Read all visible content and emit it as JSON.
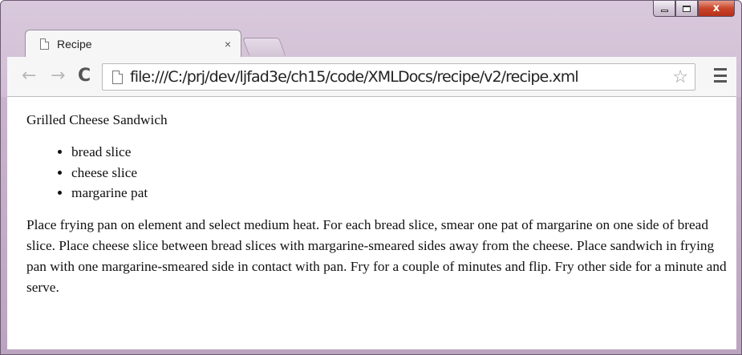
{
  "tab": {
    "title": "Recipe",
    "close_label": "×"
  },
  "toolbar": {
    "back_icon": "arrow-left-icon",
    "forward_icon": "arrow-right-icon",
    "reload_icon": "reload-icon",
    "url": "file:///C:/prj/dev/ljfad3e/ch15/code/XMLDocs/recipe/v2/recipe.xml",
    "bookmark_icon": "star-outline-icon",
    "menu_icon": "hamburger-menu-icon"
  },
  "window_controls": {
    "close_label": "x"
  },
  "document": {
    "title": "Grilled Cheese Sandwich",
    "ingredients": [
      "bread slice",
      "cheese slice",
      "margarine pat"
    ],
    "instructions": "Place frying pan on element and select medium heat. For each bread slice, smear one pat of margarine on one side of bread slice. Place cheese slice between bread slices with margarine-smeared sides away from the cheese. Place sandwich in frying pan with one margarine-smeared side in contact with pan. Fry for a couple of minutes and flip. Fry other side for a minute and serve."
  },
  "colors": {
    "frame": "#cdb9d1",
    "close_button": "#c9452a",
    "tab_background": "#f6f6f6"
  }
}
